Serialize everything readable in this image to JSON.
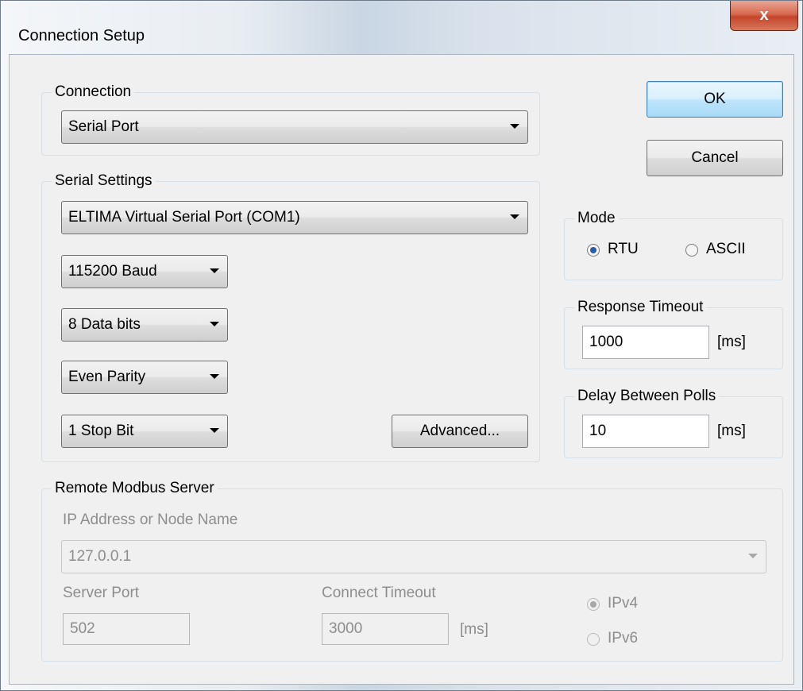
{
  "window": {
    "title": "Connection Setup",
    "close_label": "x"
  },
  "buttons": {
    "ok": "OK",
    "cancel": "Cancel",
    "advanced": "Advanced..."
  },
  "connection": {
    "label": "Connection",
    "value": "Serial Port"
  },
  "serial": {
    "label": "Serial Settings",
    "port": "ELTIMA Virtual Serial Port (COM1)",
    "baud": "115200 Baud",
    "data_bits": "8 Data bits",
    "parity": "Even Parity",
    "stop_bits": "1 Stop Bit"
  },
  "mode": {
    "label": "Mode",
    "rtu": "RTU",
    "ascii": "ASCII",
    "selected": "RTU"
  },
  "response_timeout": {
    "label": "Response Timeout",
    "value": "1000",
    "unit": "[ms]"
  },
  "delay_between_polls": {
    "label": "Delay Between Polls",
    "value": "10",
    "unit": "[ms]"
  },
  "remote": {
    "label": "Remote Modbus Server",
    "ip_label": "IP Address or Node Name",
    "ip_value": "127.0.0.1",
    "port_label": "Server Port",
    "port_value": "502",
    "connect_timeout_label": "Connect Timeout",
    "connect_timeout_value": "3000",
    "connect_timeout_unit": "[ms]",
    "ipv4": "IPv4",
    "ipv6": "IPv6",
    "selected": "IPv4"
  }
}
